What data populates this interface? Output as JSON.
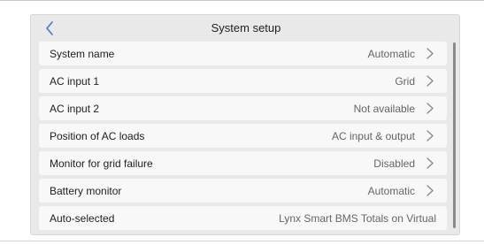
{
  "header": {
    "title": "System setup",
    "back_icon": "chevron-left-icon"
  },
  "rows": [
    {
      "label": "System name",
      "value": "Automatic",
      "arrow": true
    },
    {
      "label": "AC input 1",
      "value": "Grid",
      "arrow": true
    },
    {
      "label": "AC input 2",
      "value": "Not available",
      "arrow": true
    },
    {
      "label": "Position of AC loads",
      "value": "AC input & output",
      "arrow": true
    },
    {
      "label": "Monitor for grid failure",
      "value": "Disabled",
      "arrow": true
    },
    {
      "label": "Battery monitor",
      "value": "Automatic",
      "arrow": true
    },
    {
      "label": "Auto-selected",
      "value": "Lynx Smart BMS Totals on Virtual",
      "arrow": false
    }
  ],
  "colors": {
    "accent": "#3a7bd5",
    "background": "#e9e9e9",
    "row": "#f8f8f8"
  }
}
